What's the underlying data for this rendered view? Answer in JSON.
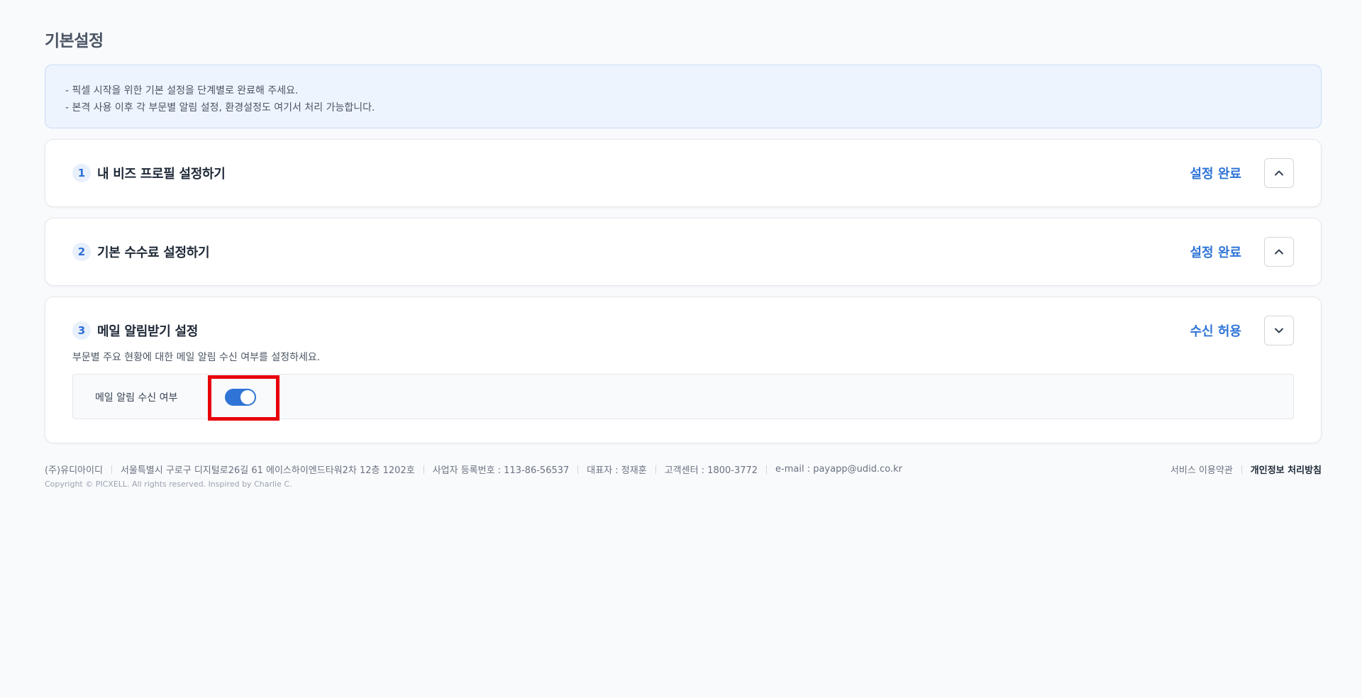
{
  "page": {
    "title": "기본설정"
  },
  "notice": {
    "lines": [
      "- 픽셀 시작을 위한 기본 설정을 단계별로 완료해 주세요.",
      "- 본격 사용 이후 각 부문별 알림 설정, 환경설정도 여기서 처리 가능합니다."
    ]
  },
  "steps": [
    {
      "number": "1",
      "title": "내 비즈 프로필 설정하기",
      "status": "설정 완료",
      "toggle_icon": "chevron-up-icon"
    },
    {
      "number": "2",
      "title": "기본 수수료 설정하기",
      "status": "설정 완료",
      "toggle_icon": "chevron-up-icon"
    },
    {
      "number": "3",
      "title": "메일 알림받기 설정",
      "status": "수신 허용",
      "toggle_icon": "chevron-down-icon",
      "description": "부문별 주요 현황에 대한 메일 알림 수신 여부를 설정하세요.",
      "setting": {
        "label": "메일 알림 수신 여부",
        "enabled": true
      }
    }
  ],
  "footer": {
    "company": "(주)유디아이디",
    "address": "서울특별시 구로구 디지털로26길 61 에이스하이엔드타워2차 12층 1202호",
    "business_number": "사업자 등록번호 : 113-86-56537",
    "ceo": "대표자 : 정재훈",
    "customer_center": "고객센터 : 1800-3772",
    "email": "e-mail : payapp@udid.co.kr",
    "copyright": "Copyright © PICXELL. All rights reserved. Inspired by Charlie C.",
    "terms_link": "서비스 이용약관",
    "privacy_link": "개인정보 처리방침"
  },
  "colors": {
    "accent": "#2f74d6",
    "highlight": "#e8000b",
    "notice_bg": "#eef4fd"
  }
}
